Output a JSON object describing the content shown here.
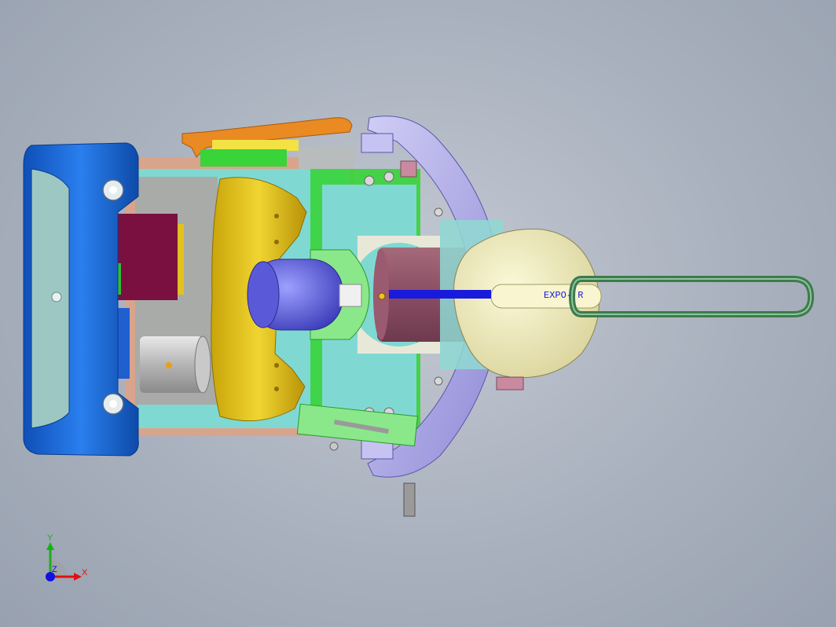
{
  "viewport": {
    "annotation_text": "EXPO- R",
    "accent_colors": {
      "background": "#a9b1be",
      "blue_cap": "#1f6fe0",
      "yellow_part": "#e2c21c",
      "orange_lever": "#e98a22",
      "green_part": "#39d33a",
      "lavender_housing": "#aaa6e6",
      "cream_motor": "#eeeab8",
      "maroon_board": "#7a1040",
      "handle_loop": "#3f7a4d"
    }
  },
  "triad": {
    "x_label": "X",
    "y_label": "Y",
    "z_label": "Z",
    "x_color": "#e01010",
    "y_color": "#18b018",
    "z_color": "#1010e0"
  }
}
